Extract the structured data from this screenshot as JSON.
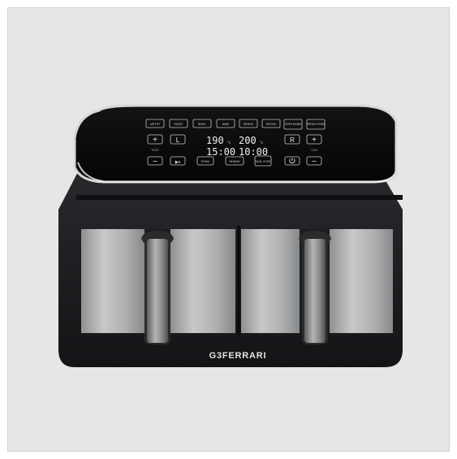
{
  "product": {
    "brand": "G3FERRARI",
    "colors": {
      "background": "#e6e6e6",
      "body": "#1a1b1d",
      "panel": "#08090a",
      "display_white": "#e9e9e9",
      "steel": "#b9bbbd"
    }
  },
  "display": {
    "presets": [
      "AIR FRY",
      "ROAST",
      "BROIL",
      "BAKE",
      "REHEAT",
      "DRYING",
      "KEEP WARM",
      "FRENCH FRIES"
    ],
    "temp_left": "190",
    "temp_right": "200",
    "temp_unit": "°c",
    "time_left": "15:00",
    "time_right": "10:00",
    "controls": {
      "plus_symbol": "+",
      "minus_symbol": "−",
      "left_zone": "L",
      "right_zone": "R",
      "temp_caption": "TEMP",
      "time_caption": "TIME",
      "play_pause": "▶⏸",
      "sync": "SYNC",
      "shake": "SHAKE",
      "dual_cook": "DUAL COOK",
      "power_icon": "power-icon"
    }
  }
}
